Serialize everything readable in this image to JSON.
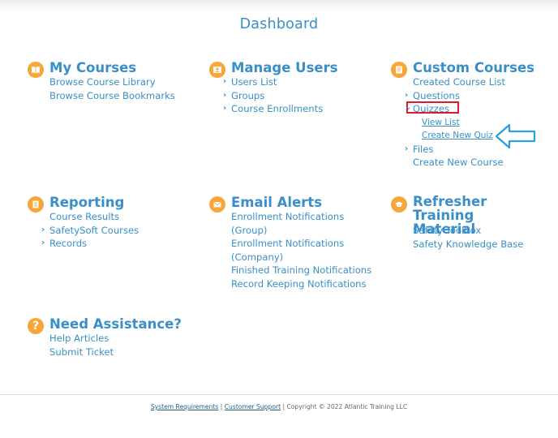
{
  "page_title": "Dashboard",
  "colors": {
    "accent": "#3a8fc9",
    "icon_bg": "#f7a63a",
    "highlight": "#d81e2c",
    "arrow": "#2a9fe0"
  },
  "sections": {
    "my_courses": {
      "title": "My Courses",
      "icon": "book-icon",
      "items": [
        "Browse Course Library",
        "Browse Course Bookmarks"
      ]
    },
    "manage_users": {
      "title": "Manage Users",
      "icon": "user-card-icon",
      "items": [
        "Users List",
        "Groups",
        "Course Enrollments"
      ]
    },
    "custom_courses": {
      "title": "Custom Courses",
      "icon": "book-edit-icon",
      "items": {
        "created": "Created Course List",
        "questions": "Questions",
        "quizzes": "Quizzes",
        "view_list": "View List",
        "create_quiz": "Create New Quiz",
        "files": "Files",
        "create_course": "Create New Course"
      }
    },
    "reporting": {
      "title": "Reporting",
      "icon": "document-icon",
      "items": [
        "Course Results",
        "SafetySoft Courses",
        "Records"
      ]
    },
    "email_alerts": {
      "title": "Email Alerts",
      "icon": "envelope-icon",
      "items": [
        "Enrollment Notifications (Group)",
        "Enrollment Notifications (Company)",
        "Finished Training Notifications",
        "Record Keeping Notifications"
      ]
    },
    "refresher": {
      "title": "Refresher Training Material",
      "icon": "graduation-cap-icon",
      "items": [
        "Safety Toolbox",
        "Safety Knowledge Base"
      ]
    },
    "assistance": {
      "title": "Need Assistance?",
      "icon": "question-icon",
      "items": [
        "Help Articles",
        "Submit Ticket"
      ]
    }
  },
  "footer": {
    "system_requirements": "System Requirements",
    "separator": " | ",
    "customer_support": "Customer Support",
    "copyright": " | Copyright © 2022 Atlantic Training LLC"
  }
}
